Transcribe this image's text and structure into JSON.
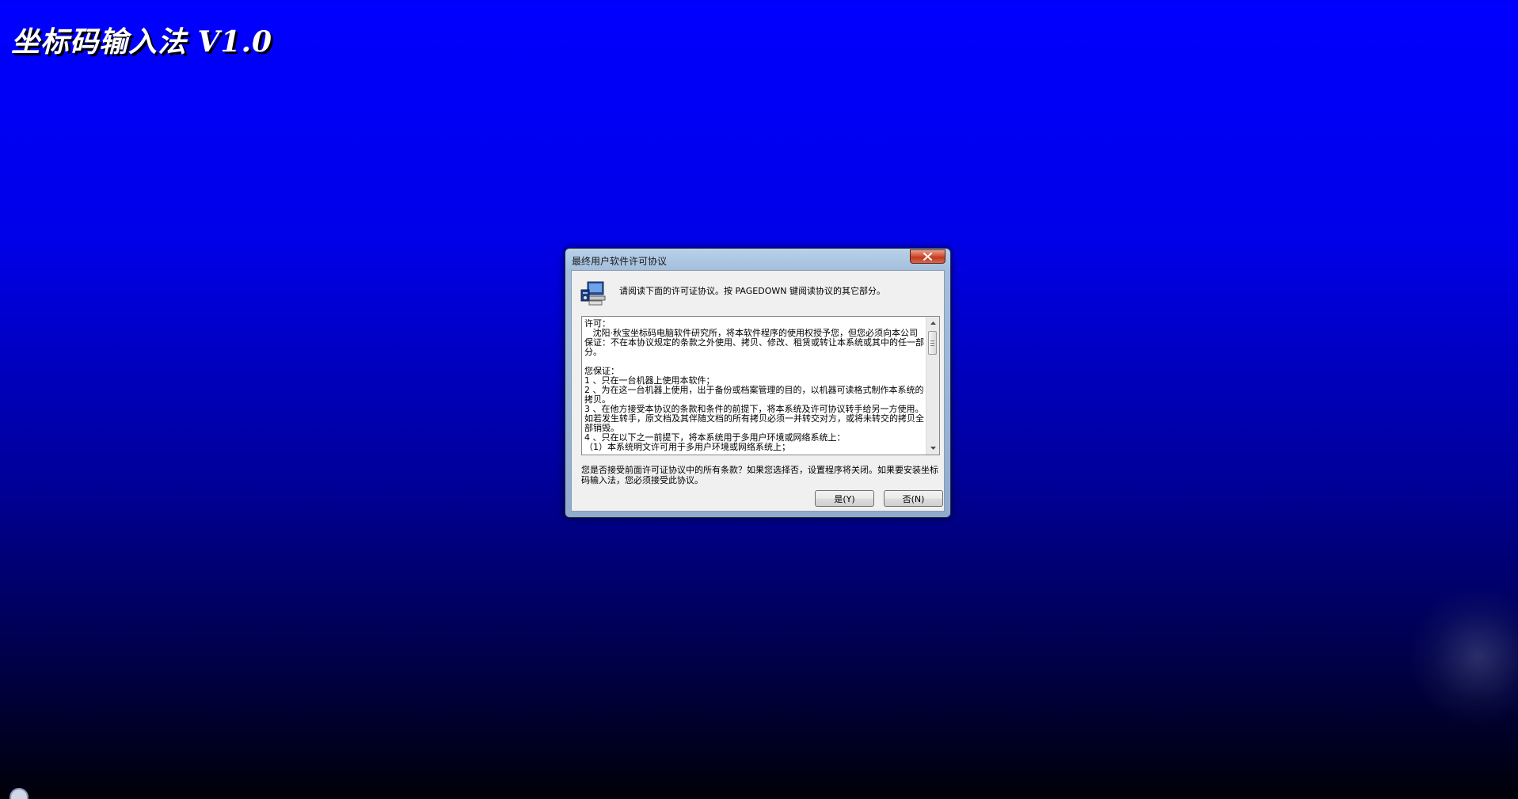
{
  "app": {
    "title": "坐标码输入法 V1.0"
  },
  "dialog": {
    "title": "最终用户软件许可协议",
    "close_glyph": "x",
    "header_text": "请阅读下面的许可证协议。按 PAGEDOWN 键阅读协议的其它部分。",
    "license_text": "许可：\n   沈阳·秋宝坐标码电脑软件研究所，将本软件程序的使用权授予您，但您必须向本公司保证：不在本协议规定的条款之外使用、拷贝、修改、租赁或转让本系统或其中的任一部分。\n\n您保证：\n1 、只在一台机器上使用本软件；\n2 、为在这一台机器上使用，出于备份或档案管理的目的，以机器可读格式制作本系统的拷贝。\n3 、在他方接受本协议的条款和条件的前提下，将本系统及许可协议转手给另一方使用。如若发生转手，原文档及其伴随文档的所有拷贝必须一并转交对方，或将未转交的拷贝全部销毁。\n4 、只在以下之一前提下，将本系统用于多用户环境或网络系统上：\n（1）本系统明文许可用于多用户环境或网络系统上；",
    "question_text": "您是否接受前面许可证协议中的所有条款？如果您选择否，设置程序将关闭。如果要安装坐标码输入法，您必须接受此协议。",
    "yes_label": "是(Y)",
    "no_label": "否(N)"
  },
  "icons": {
    "setup": "setup-computer-icon",
    "close": "close-icon"
  }
}
